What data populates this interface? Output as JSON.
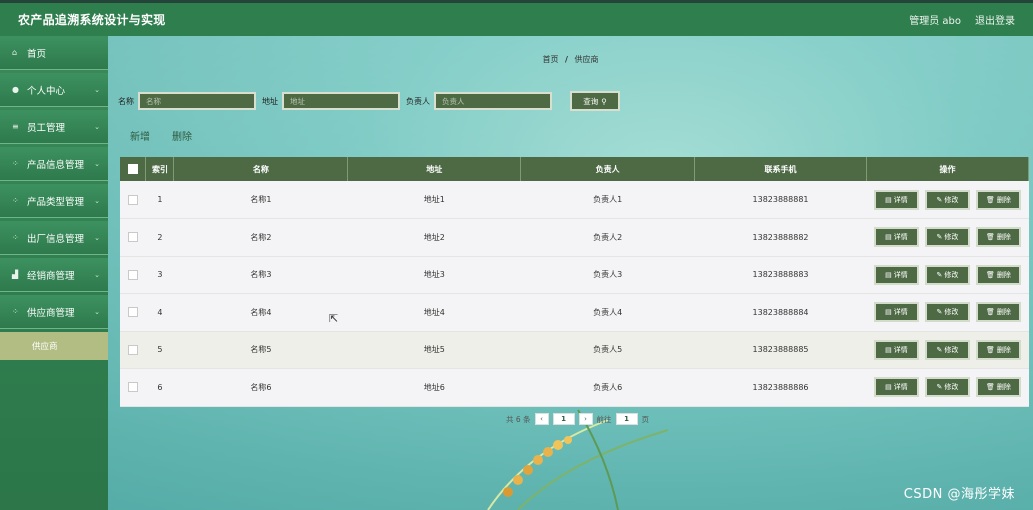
{
  "header": {
    "title": "农产品追溯系统设计与实现",
    "user": "管理员 abo",
    "logout": "退出登录"
  },
  "sidebar": {
    "items": [
      {
        "label": "首页",
        "icon": "home-icon",
        "glyph": "⌂",
        "chevron": false
      },
      {
        "label": "个人中心",
        "icon": "user-icon",
        "glyph": "●",
        "chevron": true
      },
      {
        "label": "员工管理",
        "icon": "list-icon",
        "glyph": "≡",
        "chevron": true
      },
      {
        "label": "产品信息管理",
        "icon": "grid-icon",
        "glyph": "⁘",
        "chevron": true
      },
      {
        "label": "产品类型管理",
        "icon": "grid-icon",
        "glyph": "⁘",
        "chevron": true
      },
      {
        "label": "出厂信息管理",
        "icon": "grid-icon",
        "glyph": "⁘",
        "chevron": true
      },
      {
        "label": "经销商管理",
        "icon": "chart-icon",
        "glyph": "▟",
        "chevron": true
      },
      {
        "label": "供应商管理",
        "icon": "grid-icon",
        "glyph": "⁘",
        "chevron": true
      }
    ],
    "sub_item": "供应商"
  },
  "breadcrumb": {
    "home": "首页",
    "sep": "/",
    "current": "供应商"
  },
  "search": {
    "name_label": "名称",
    "name_placeholder": "名称",
    "addr_label": "地址",
    "addr_placeholder": "地址",
    "person_label": "负责人",
    "person_placeholder": "负责人",
    "button": "查询"
  },
  "actions": {
    "add": "新增",
    "delete": "删除"
  },
  "table": {
    "headers": [
      "索引",
      "名称",
      "地址",
      "负责人",
      "联系手机",
      "操作"
    ],
    "rows": [
      {
        "index": "1",
        "name": "名称1",
        "addr": "地址1",
        "person": "负责人1",
        "phone": "13823888881"
      },
      {
        "index": "2",
        "name": "名称2",
        "addr": "地址2",
        "person": "负责人2",
        "phone": "13823888882"
      },
      {
        "index": "3",
        "name": "名称3",
        "addr": "地址3",
        "person": "负责人3",
        "phone": "13823888883"
      },
      {
        "index": "4",
        "name": "名称4",
        "addr": "地址4",
        "person": "负责人4",
        "phone": "13823888884"
      },
      {
        "index": "5",
        "name": "名称5",
        "addr": "地址5",
        "person": "负责人5",
        "phone": "13823888885"
      },
      {
        "index": "6",
        "name": "名称6",
        "addr": "地址6",
        "person": "负责人6",
        "phone": "13823888886"
      }
    ],
    "ops": {
      "detail": "详情",
      "edit": "修改",
      "delete": "删除"
    }
  },
  "pager": {
    "total": "共 6 条",
    "page": "1",
    "goto_pre": "前往",
    "goto_val": "1",
    "goto_post": "页"
  },
  "watermark": "CSDN @海彤学妹",
  "colors": {
    "primary": "#2f7e4e",
    "button": "#4e6a45",
    "sub_item": "#b2bd84"
  }
}
